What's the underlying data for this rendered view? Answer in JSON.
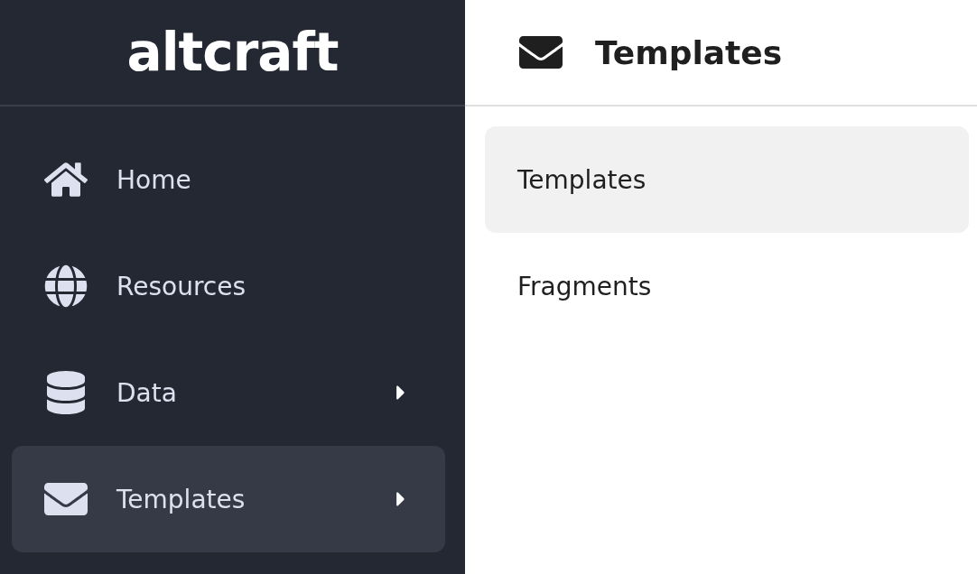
{
  "logo": {
    "text": "altcraft"
  },
  "sidebar": {
    "items": [
      {
        "label": "Home",
        "kind": "home",
        "selected": false,
        "has_submenu": false
      },
      {
        "label": "Resources",
        "kind": "globe",
        "selected": false,
        "has_submenu": false
      },
      {
        "label": "Data",
        "kind": "database",
        "selected": false,
        "has_submenu": true
      },
      {
        "label": "Templates",
        "kind": "envelope",
        "selected": true,
        "has_submenu": true
      }
    ]
  },
  "submenu": {
    "title": "Templates",
    "items": [
      {
        "label": "Templates",
        "selected": true
      },
      {
        "label": "Fragments",
        "selected": false
      }
    ]
  }
}
